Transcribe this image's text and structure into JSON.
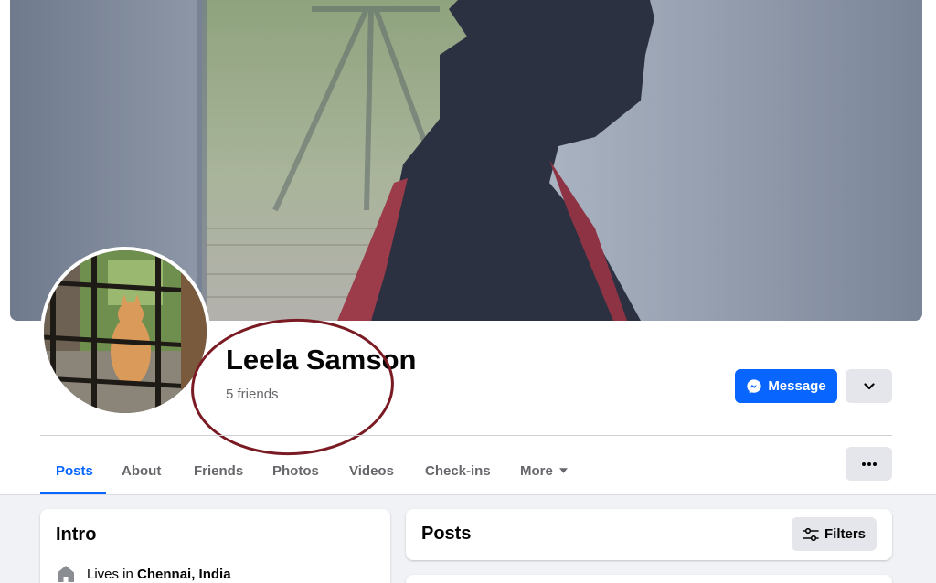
{
  "profile": {
    "name": "Leela Samson",
    "friends": "5 friends"
  },
  "actions": {
    "message_label": "Message"
  },
  "tabs": [
    {
      "label": "Posts",
      "active": true
    },
    {
      "label": "About",
      "active": false
    },
    {
      "label": "Friends",
      "active": false
    },
    {
      "label": "Photos",
      "active": false
    },
    {
      "label": "Videos",
      "active": false
    },
    {
      "label": "Check-ins",
      "active": false
    },
    {
      "label": "More",
      "active": false
    }
  ],
  "intro": {
    "title": "Intro",
    "lives_prefix": "Lives in ",
    "lives_city": "Chennai, India"
  },
  "posts": {
    "title": "Posts",
    "filters_label": "Filters"
  },
  "colors": {
    "accent": "#0866ff",
    "annotation_ellipse": "#7a1b24",
    "button_grey": "#e4e6eb",
    "page_background": "#f0f2f5"
  },
  "icons": {
    "message_button": "messenger-icon",
    "dropdown_button": "chevron-down-icon",
    "more_tab": "caret-down-icon",
    "more_button": "ellipsis-icon",
    "lives_in": "home-icon",
    "filters_button": "sliders-icon"
  }
}
